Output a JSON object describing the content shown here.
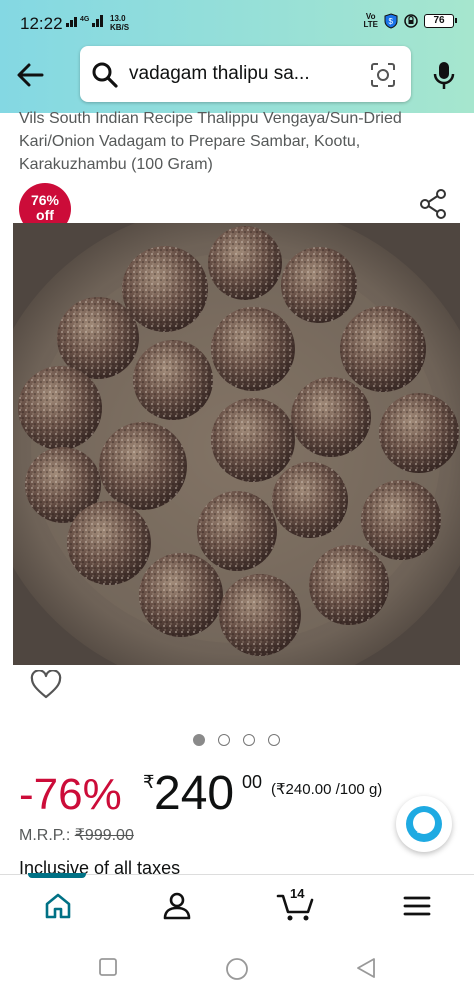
{
  "status_bar": {
    "time": "12:22",
    "network": "4G",
    "speed_value": "13.0",
    "speed_unit": "KB/S",
    "volte_top": "Vo",
    "volte_bottom": "LTE",
    "battery": "76"
  },
  "search": {
    "query": "vadagam thalipu sa...",
    "icons": [
      "back-arrow-icon",
      "search-icon",
      "camera-lens-icon",
      "microphone-icon"
    ]
  },
  "product": {
    "title": "Vils South Indian Recipe Thalippu Vengaya/Sun-Dried Kari/Onion Vadagam to Prepare Sambar, Kootu, Karakuzhambu (100 Gram)",
    "discount_badge_top": "76%",
    "discount_badge_bottom": "off",
    "image_pages": 4,
    "active_page": 1
  },
  "price": {
    "discount": "-76%",
    "currency": "₹",
    "whole": "240",
    "fraction": "00",
    "unit_price": "(₹240.00 /100 g)",
    "mrp_label": "M.R.P.:",
    "mrp_value": "₹999.00",
    "taxes": "Inclusive of all taxes"
  },
  "bottom_nav": {
    "items": [
      "home-icon",
      "account-icon",
      "cart-icon",
      "menu-icon"
    ],
    "cart_count": "14"
  },
  "colors": {
    "header_gradient_start": "#84d8e3",
    "header_gradient_end": "#a6e6ce",
    "deal_red": "#cc0c39",
    "nav_accent": "#007185",
    "alexa_blue": "#1eaae2"
  }
}
